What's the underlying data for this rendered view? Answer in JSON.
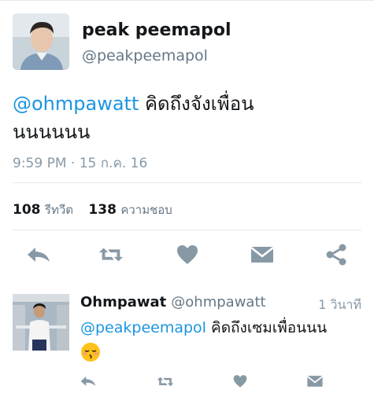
{
  "tweet": {
    "display_name": "peak peemapol",
    "handle": "@peakpeemapol",
    "mention": "@ohmpawatt",
    "text_line1_rest": " คิดถึงจังเพื่อน",
    "text_line2": "นนนนนน",
    "timestamp": "9:59 PM · 15 ก.ค. 16",
    "retweets_count": "108",
    "retweets_label": "รีทวีต",
    "likes_count": "138",
    "likes_label": "ความชอบ"
  },
  "actions": [
    "reply-icon",
    "retweet-icon",
    "heart-icon",
    "message-icon",
    "share-icon"
  ],
  "reply": {
    "display_name": "Ohmpawat",
    "handle": "@ohmpawatt",
    "time": "1 วินาที",
    "mention": "@peakpeemapol",
    "text_rest": " คิดถึงเซมเพื่อนนน",
    "emoji": "kissing-face-closed-eyes-emoji"
  },
  "colors": {
    "link": "#1b95e0",
    "icon": "#8899a6",
    "text": "#14171a",
    "muted": "#657786",
    "divider": "#e1e8ed"
  }
}
